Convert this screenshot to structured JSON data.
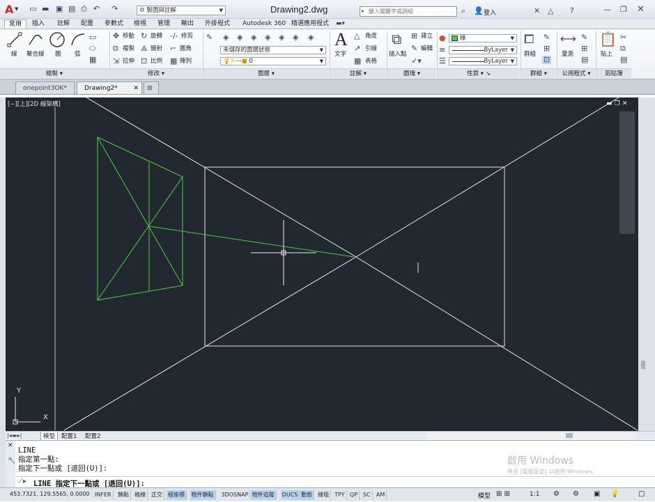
{
  "app": {
    "doc_title": "Drawing2.dwg",
    "workspace": "製圖與註解",
    "search_placeholder": "鍵入關鍵字或詞組",
    "login": "登入",
    "app_letter": "A"
  },
  "ribbon_tabs": [
    "常用",
    "插入",
    "註解",
    "配置",
    "參數式",
    "檢視",
    "管理",
    "輸出",
    "外掛程式",
    "Autodesk 360",
    "精選應用程式"
  ],
  "ribbon": {
    "draw": {
      "line": "線",
      "polyline": "聚合線",
      "circle": "圓",
      "arc": "弧",
      "footer": "繪製"
    },
    "modify": {
      "move": "移動",
      "rotate": "旋轉",
      "trim": "修剪",
      "copy": "複製",
      "mirror": "鏡射",
      "fillet": "圓角",
      "stretch": "拉伸",
      "scale": "比例",
      "array": "陣列",
      "footer": "修改"
    },
    "layers": {
      "state": "未儲存的圖層狀態",
      "current": "0",
      "footer": "圖層"
    },
    "annotation": {
      "text": "文字",
      "dimension": "標註",
      "angle": "角度",
      "leader": "引線",
      "table": "表格",
      "footer": "註解"
    },
    "block": {
      "insert": "插入點",
      "create": "建立",
      "edit": "編輯",
      "footer": "圖塊"
    },
    "properties": {
      "color": "綠",
      "linetype": "ByLayer",
      "lineweight": "ByLayer",
      "footer": "性質"
    },
    "groups": {
      "group": "群組",
      "footer": "群組"
    },
    "utilities": {
      "measure": "量測",
      "footer": "公用程式"
    },
    "clipboard": {
      "paste": "貼上",
      "footer": "剪貼簿"
    }
  },
  "file_tabs": [
    "onepoint3OK*",
    "Drawing2*"
  ],
  "viewport_label": "[−][上][2D 線架構]",
  "layout_tabs": [
    "模型",
    "配置1",
    "配置2"
  ],
  "command": {
    "history": [
      "LINE",
      "指定第一點:",
      "指定下一點或 [退回(U)]:"
    ],
    "prompt": "LINE 指定下一點或 [退回(U)]:"
  },
  "watermark": [
    "啟用 Windows",
    "移至 [電腦設定] 以啟用 Windows。"
  ],
  "status": {
    "coords": "453.7321, 129.5565, 0.0000",
    "toggles": [
      "INFER",
      "鎖點",
      "格線",
      "正交",
      "極座標",
      "物件鎖點",
      "3DOSNAP",
      "物件追蹤",
      "DUCS",
      "動態",
      "線粗",
      "TPY",
      "QP",
      "SC",
      "AM"
    ],
    "toggles_on": [
      4,
      5,
      7,
      8,
      9
    ],
    "model": "模型",
    "scale": "1:1"
  },
  "axis": {
    "y": "Y",
    "x": "X"
  },
  "colors": {
    "bg": "#212830",
    "green": "#4ccf3c",
    "white": "#e8e8e8",
    "accent": "#c62a2a"
  }
}
